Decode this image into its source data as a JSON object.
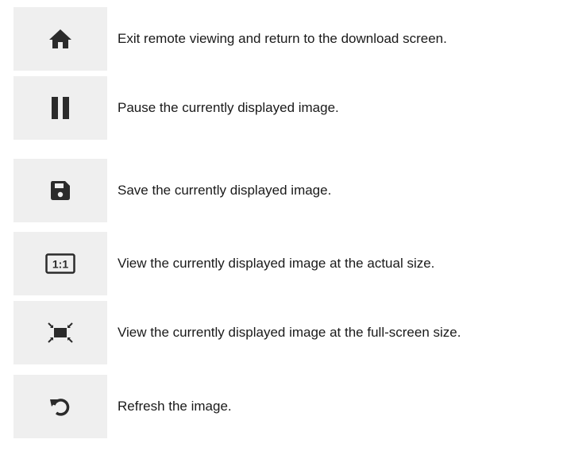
{
  "icon_color": "#2b2b2b",
  "tile_color": "#efefef",
  "rows": [
    {
      "icon": "home-icon",
      "text": "Exit remote viewing and return to the download screen."
    },
    {
      "icon": "pause-icon",
      "text": "Pause the currently displayed image."
    },
    {
      "icon": "save-icon",
      "text": "Save the currently displayed image."
    },
    {
      "icon": "actual-size-icon",
      "icon_label": "1:1",
      "text": "View the currently displayed image at the actual size."
    },
    {
      "icon": "fullscreen-icon",
      "text": "View the currently displayed image at the full-screen size."
    },
    {
      "icon": "refresh-icon",
      "text": "Refresh the image."
    }
  ]
}
